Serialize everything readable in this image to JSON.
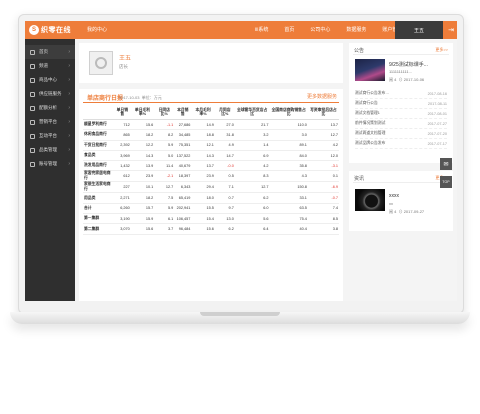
{
  "header": {
    "logo_text": "织零在线",
    "logo_mark": "S",
    "breadcrumb": "我的中心",
    "nav": [
      "iii系统",
      "首页",
      "公司中心",
      "数据服务",
      "账户管理"
    ],
    "user": "王五",
    "exit_icon": "exit-icon"
  },
  "sidebar": {
    "items": [
      {
        "label": "首页",
        "icon": "home-icon"
      },
      {
        "label": "频道",
        "icon": "channel-icon"
      },
      {
        "label": "商品中心",
        "icon": "goods-icon"
      },
      {
        "label": "供应链服务",
        "icon": "supply-icon"
      },
      {
        "label": "配额分析",
        "icon": "quota-icon"
      },
      {
        "label": "营销平台",
        "icon": "marketing-icon"
      },
      {
        "label": "互动平台",
        "icon": "interact-icon"
      },
      {
        "label": "品类管理",
        "icon": "category-icon"
      },
      {
        "label": "账号管理",
        "icon": "account-icon"
      }
    ]
  },
  "profile": {
    "name": "王五",
    "role": "店长"
  },
  "report": {
    "title": "单店商行日报",
    "date": "2017-10-03",
    "unit": "单位：万元",
    "more": "更多数据服务",
    "columns": [
      "",
      "单日销售",
      "单日毛利率%",
      "日同店比%",
      "本月销售",
      "本月毛利率%",
      "月同店比%",
      "全球奢华百货店占比",
      "全国商店商购销售占比",
      "写资审批后店占比"
    ],
    "rows": [
      {
        "name": "顺星罗利商行",
        "c": [
          "712",
          "15.6",
          "-1.1",
          "27,686",
          "14.9",
          "27.0",
          "21.7",
          "110.0",
          "13.7"
        ]
      },
      {
        "name": "休闲食品商行",
        "c": [
          "865",
          "18.2",
          "8.2",
          "34,485",
          "18.8",
          "31.8",
          "3.2",
          "3.0",
          "12.7"
        ]
      },
      {
        "name": "干货日批商行",
        "c": [
          "2,392",
          "12.2",
          "5.9",
          "75,351",
          "12.1",
          "4.9",
          "1.4",
          "89.1",
          "4.2"
        ]
      },
      {
        "name": "食品类",
        "c": [
          "3,969",
          "14.3",
          "5.0",
          "137,522",
          "14.3",
          "14.7",
          "6.9",
          "84.0",
          "12.0"
        ]
      },
      {
        "name": "洗发用品商行",
        "c": [
          "1,432",
          "13.9",
          "11.4",
          "40,679",
          "13.7",
          "-0.0",
          "4.2",
          "35.8",
          "-3.1"
        ]
      },
      {
        "name": "家客完家居电商行",
        "c": [
          "612",
          "23.9",
          "-2.1",
          "18,397",
          "23.9",
          "0.5",
          "8.3",
          "4.3",
          "0.1"
        ]
      },
      {
        "name": "家银生活家电商行",
        "c": [
          "227",
          "10.1",
          "12.7",
          "6,343",
          "29.4",
          "7.1",
          "12.7",
          "150.8",
          "-6.9"
        ]
      },
      {
        "name": "用品类",
        "c": [
          "2,271",
          "18.2",
          "7.5",
          "65,419",
          "18.0",
          "0.7",
          "6.2",
          "33.1",
          "-0.7"
        ]
      },
      {
        "name": "合计",
        "c": [
          "6,260",
          "15.7",
          "5.9",
          "202,941",
          "15.5",
          "9.7",
          "6.0",
          "63.5",
          "7.4"
        ]
      },
      {
        "name": "第一集群",
        "c": [
          "3,190",
          "15.9",
          "6.1",
          "106,457",
          "15.4",
          "13.0",
          "5.6",
          "75.4",
          "8.5"
        ]
      },
      {
        "name": "第二集群",
        "c": [
          "3,070",
          "15.6",
          "3.7",
          "96,484",
          "15.6",
          "6.2",
          "6.4",
          "40.4",
          "3.8"
        ]
      }
    ]
  },
  "notice": {
    "title": "公告",
    "more": "更多>>",
    "feature_title": "9/25测试标课手...",
    "feature_sub": "1111111111...",
    "feature_meta_left": "阅 4",
    "feature_meta_right": "⊙ 2017-10-06",
    "items": [
      {
        "t": "测试商行公告发布…",
        "d": "2017-08-16"
      },
      {
        "t": "测试商行公告",
        "d": "2017-08-11"
      },
      {
        "t": "测试文档管理1",
        "d": "2017-08-01"
      },
      {
        "t": "前件情况策划测试",
        "d": "2017-07-27"
      },
      {
        "t": "测试两道文档管理",
        "d": "2017-07-20"
      },
      {
        "t": "测试品牌公告发布",
        "d": "2017-07-17"
      }
    ]
  },
  "material": {
    "title": "资讯",
    "more": "更多>>",
    "feature_title": "xxxx",
    "feature_sub": "xx",
    "feature_meta_left": "阅 4",
    "feature_meta_right": "⊙ 2017-09-27"
  },
  "floating": {
    "mail_icon": "mail-icon",
    "top_label": "TOP"
  }
}
